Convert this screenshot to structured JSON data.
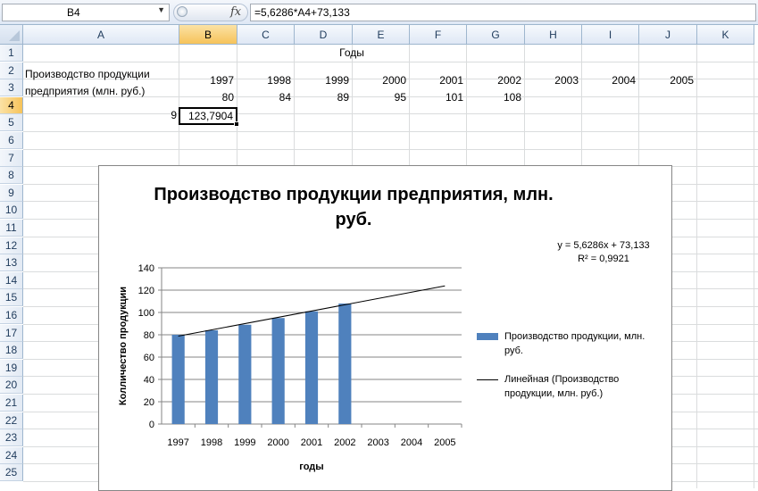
{
  "formula_bar": {
    "name_box": "B4",
    "fx_label": "fx",
    "formula": "=5,6286*A4+73,133"
  },
  "columns": [
    "A",
    "B",
    "C",
    "D",
    "E",
    "F",
    "G",
    "H",
    "I",
    "J",
    "K"
  ],
  "active_column": "B",
  "rows": [
    "1",
    "2",
    "3",
    "4",
    "5",
    "6",
    "7",
    "8",
    "9",
    "10",
    "11",
    "12",
    "13",
    "14",
    "15",
    "16",
    "17",
    "18",
    "19",
    "20",
    "21",
    "22",
    "23",
    "24",
    "25"
  ],
  "active_row": "4",
  "cells": {
    "header_years": "Годы",
    "a_label_line1": "Производство продукции",
    "a_label_line2": "предприятия (млн. руб.)",
    "years": [
      "1997",
      "1998",
      "1999",
      "2000",
      "2001",
      "2002",
      "2003",
      "2004",
      "2005"
    ],
    "values": [
      "80",
      "84",
      "89",
      "95",
      "101",
      "108"
    ],
    "a4": "9",
    "b4": "123,7904"
  },
  "chart_data": {
    "type": "bar",
    "title": "Производство продукции предприятия, млн. руб.",
    "title_line1": "Производство продукции предприятия, млн.",
    "title_line2": "руб.",
    "xlabel": "годы",
    "ylabel": "Колличество  продукции",
    "categories": [
      "1997",
      "1998",
      "1999",
      "2000",
      "2001",
      "2002",
      "2003",
      "2004",
      "2005"
    ],
    "series": [
      {
        "name": "Производство продукции, млн. руб.",
        "values": [
          80,
          84,
          89,
          95,
          101,
          108,
          null,
          null,
          null
        ],
        "color": "#4f81bd"
      }
    ],
    "trendline": {
      "name": "Линейная (Производство продукции, млн. руб.)",
      "type": "linear",
      "slope": 5.6286,
      "intercept": 73.133,
      "equation": "y = 5,6286x + 73,133",
      "r2": "R² = 0,9921"
    },
    "ylim": [
      0,
      140
    ],
    "yticks": [
      "0",
      "20",
      "40",
      "60",
      "80",
      "100",
      "120",
      "140"
    ],
    "grid": true,
    "legend_position": "right",
    "legend": {
      "item1_line1": "Производство продукции, млн.",
      "item1_line2": "руб.",
      "item2_line1": "Линейная (Производство",
      "item2_line2": "продукции, млн. руб.)"
    }
  }
}
